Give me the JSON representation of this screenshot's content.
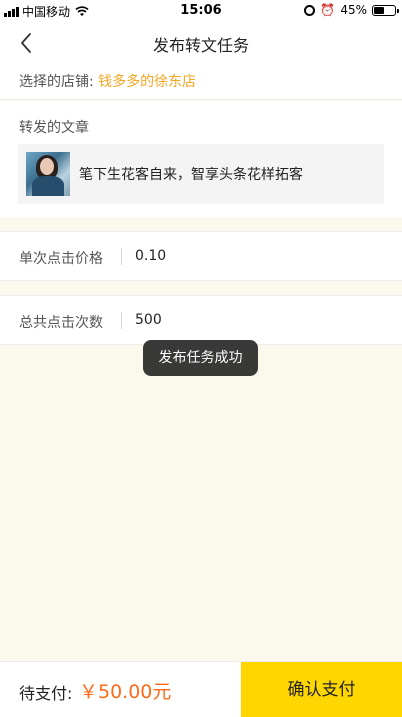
{
  "status_bar": {
    "carrier": "中国移动",
    "time": "15:06",
    "battery": "45%",
    "battery_level": 0.45
  },
  "nav": {
    "title": "发布转文任务",
    "back_icon": "chevron-left-icon"
  },
  "store": {
    "label": "选择的店铺:",
    "value": "钱多多的徐东店"
  },
  "article": {
    "section_label": "转发的文章",
    "title": "笔下生花客自来，智享头条花样拓客"
  },
  "fields": {
    "price_label": "单次点击价格",
    "price_value": "0.10",
    "count_label": "总共点击次数",
    "count_value": "500"
  },
  "toast": {
    "message": "发布任务成功"
  },
  "footer": {
    "pay_label": "待支付:",
    "pay_amount": "￥50.00元",
    "confirm_label": "确认支付"
  },
  "colors": {
    "accent": "#ffd700",
    "store_highlight": "#f5a623",
    "amount": "#ff6a1a",
    "page_bg": "#fbf9ec"
  }
}
